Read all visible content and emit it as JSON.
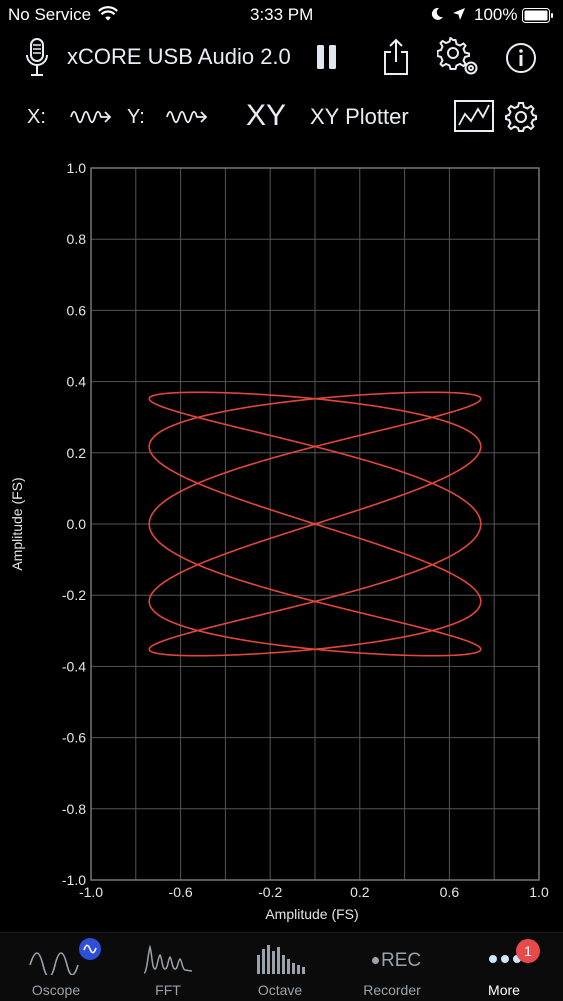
{
  "status_bar": {
    "carrier": "No Service",
    "time": "3:33 PM",
    "battery": "100%"
  },
  "header": {
    "device_name": "xCORE USB Audio 2.0"
  },
  "subheader": {
    "x_label": "X:",
    "y_label": "Y:",
    "mode_symbol": "XY",
    "mode_title": "XY Plotter"
  },
  "chart_data": {
    "type": "line",
    "xlabel": "Amplitude (FS)",
    "ylabel": "Amplitude (FS)",
    "xlim": [
      -1.0,
      1.0
    ],
    "ylim": [
      -1.0,
      1.0
    ],
    "x_ticks": [
      "-1.0",
      "-0.6",
      "-0.2",
      "0.2",
      "0.6",
      "1.0"
    ],
    "y_ticks": [
      "1.0",
      "0.8",
      "0.6",
      "0.4",
      "0.2",
      "0.0",
      "-0.2",
      "-0.4",
      "-0.6",
      "-0.8",
      "-1.0"
    ],
    "grid": true,
    "line_color": "#e0473c",
    "series": [
      {
        "curve": "lissajous",
        "x_amplitude": 0.74,
        "y_amplitude": 0.37,
        "x_frequency": 5,
        "y_frequency": 2
      }
    ]
  },
  "tabs": [
    {
      "label": "Oscope",
      "icon": "oscope-icon"
    },
    {
      "label": "FFT",
      "icon": "fft-icon"
    },
    {
      "label": "Octave",
      "icon": "octave-icon"
    },
    {
      "label": "Recorder",
      "icon": "rec-icon",
      "icon_text": "REC"
    },
    {
      "label": "More",
      "icon": "more-icon",
      "badge": "1"
    }
  ],
  "colors": {
    "accent": "#e0473c",
    "grid": "#555555",
    "badge": "#e84a4a"
  }
}
